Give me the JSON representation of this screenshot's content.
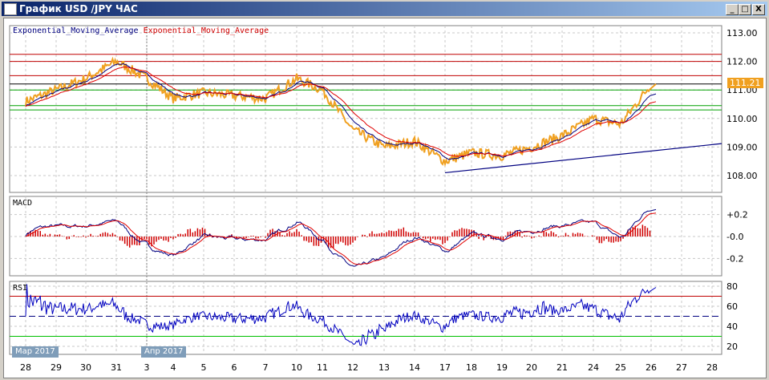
{
  "window": {
    "title": "График USD /JPY  ЧАС",
    "minimize": "_",
    "maximize": "□",
    "close": "X"
  },
  "legend": {
    "ema1": "Exponential_Moving_Average",
    "ema2": "Exponential_Moving_Average"
  },
  "panels": {
    "macd": "MACD",
    "rsi": "RSI"
  },
  "current_price": "111.21",
  "month_tags": [
    {
      "label": "Мар 2017"
    },
    {
      "label": "Апр 2017"
    }
  ],
  "colors": {
    "price": "#f0a020",
    "ema_fast": "#000080",
    "ema_slow": "#e00000",
    "resistance": "#c00000",
    "support": "#00a000"
  },
  "chart_data": {
    "type": "line",
    "title": "USD/JPY H1",
    "x_ticks": [
      "28",
      "29",
      "30",
      "31",
      "3",
      "4",
      "5",
      "6",
      "7",
      "10",
      "11",
      "12",
      "13",
      "14",
      "17",
      "18",
      "19",
      "20",
      "21",
      "24",
      "25",
      "26",
      "27",
      "28"
    ],
    "daily_close": [
      110.6,
      111.0,
      111.4,
      112.0,
      111.4,
      110.7,
      110.9,
      110.8,
      110.7,
      111.4,
      111.0,
      109.6,
      109.0,
      109.2,
      108.5,
      108.8,
      108.7,
      109.0,
      109.4,
      110.0,
      109.8,
      111.2
    ],
    "price_axis": {
      "ticks": [
        "113.00",
        "112.00",
        "111.00",
        "110.00",
        "109.00",
        "108.00"
      ],
      "range": [
        107.75,
        113.25
      ]
    },
    "macd_axis": {
      "ticks": [
        "+0.2",
        "-0.0",
        "-0.2"
      ]
    },
    "rsi_axis": {
      "ticks": [
        "80",
        "60",
        "40",
        "20"
      ],
      "levels": [
        70,
        50,
        30
      ]
    },
    "resistance_levels": [
      112.25,
      112.0,
      111.5
    ],
    "support_levels": [
      111.0,
      110.45,
      110.3
    ],
    "current_level": 111.21,
    "trendline": {
      "from": {
        "day": "17",
        "price": 108.1
      },
      "to": {
        "day": "28",
        "price": 109.1
      }
    }
  }
}
